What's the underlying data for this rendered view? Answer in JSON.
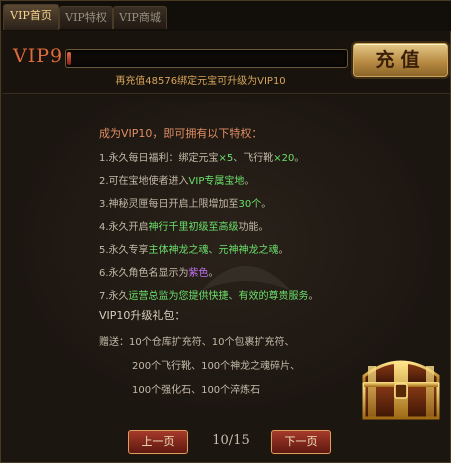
{
  "tabs": [
    {
      "label": "VIP首页",
      "active": true
    },
    {
      "label": "VIP特权",
      "active": false
    },
    {
      "label": "VIP商城",
      "active": false
    }
  ],
  "header": {
    "vip_level": "VIP9",
    "progress_fraction": 0.01,
    "upgrade_hint": "再充值48576绑定元宝可升级为VIP10",
    "recharge_label": "充值"
  },
  "privileges": {
    "title": "成为VIP10，即可拥有以下特权：",
    "items": [
      {
        "prefix": "1.永久每日福利：绑定元宝",
        "hl1": "×5",
        "mid": "、飞行靴",
        "hl2": "×20",
        "suffix": "。"
      },
      {
        "prefix": "2.可在宝地使者进入",
        "hl1": "VIP专属宝地",
        "suffix": "。"
      },
      {
        "prefix": "3.神秘灵匣每日开启上限增加至",
        "hl1": "30个",
        "suffix": "。"
      },
      {
        "prefix": "4.永久开启",
        "hl1": "神行千里初级至高级",
        "suffix": "功能。"
      },
      {
        "prefix": "5.永久专享",
        "hl1": "主体神龙之魂、元神神龙之魂",
        "suffix": "。"
      },
      {
        "prefix": "6.永久角色名显示为",
        "hl1": "紫色",
        "suffix": "。"
      },
      {
        "prefix": "7.永久",
        "hl1": "运营总监为您提供快捷、有效的尊贵服务",
        "suffix": "。"
      }
    ]
  },
  "gift": {
    "title": "VIP10升级礼包：",
    "lines": [
      "赠送：10个仓库扩充符、10个包裹扩充符、",
      "200个飞行靴、100个神龙之魂碎片、",
      "100个强化石、100个淬炼石"
    ]
  },
  "pagination": {
    "prev_label": "上一页",
    "page_text": "10/15",
    "next_label": "下一页"
  },
  "colors": {
    "accent_gold": "#f0c040",
    "accent_green": "#6be06b",
    "vip_red": "#e06b3c",
    "button_red": "#a63a2a"
  }
}
